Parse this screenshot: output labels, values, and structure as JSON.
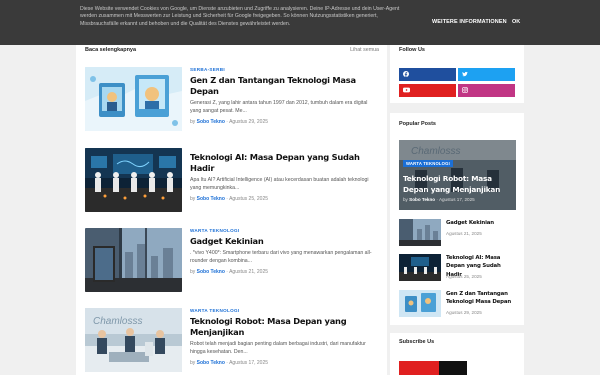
{
  "cookie_banner": {
    "text": "Diese Website verwendet Cookies von Google, um Dienste anzubieten und Zugriffe zu analysieren. Deine IP-Adresse und dein User-Agent werden zusammen mit Messwerten zur Leistung und Sicherheit für Google freigegeben. So können Nutzungsstatistiken generiert, Missbrauchsfälle erkannt und behoben und die Qualität des Dienstes gewährleistet werden.",
    "more_info": "WEITERE INFORMATIONEN",
    "ok": "OK"
  },
  "main": {
    "heading": "Baca selengkapnya",
    "see_all": "Lihat semua",
    "posts": [
      {
        "label": "SERBA-SERBI",
        "title": "Gen Z dan Tantangan Teknologi Masa Depan",
        "snippet": "Generasi Z, yang lahir antara tahun 1997 dan 2012, tumbuh dalam era digital yang sangat pesat. Me...",
        "by": "by",
        "author": "Sobo Tekno",
        "date": "Agustus 29, 2025"
      },
      {
        "label": "",
        "title": "Teknologi AI: Masa Depan yang Sudah Hadir",
        "snippet": "Apa Itu AI? Artificial Intelligence (AI) atau kecerdasan buatan adalah teknologi yang memungkinka...",
        "by": "by",
        "author": "Sobo Tekno",
        "date": "Agustus 25, 2025"
      },
      {
        "label": "WARTA TEKNOLOGI",
        "title": "Gadget Kekinian",
        "snippet": ". *vivo Y400*: Smartphone terbaru dari vivo yang menawarkan pengalaman all-rounder dengan kombina...",
        "by": "by",
        "author": "Sobo Tekno",
        "date": "Agustus 21, 2025"
      },
      {
        "label": "WARTA TEKNOLOGI",
        "title": "Teknologi Robot: Masa Depan yang Menjanjikan",
        "snippet": "Robot telah menjadi bagian penting dalam berbagai industri, dari manufaktur hingga kesehatan. Den...",
        "by": "by",
        "author": "Sobo Tekno",
        "date": "Agustus 17, 2025"
      }
    ]
  },
  "sidebar": {
    "follow_title": "Follow Us",
    "popular_title": "Popular Posts",
    "subscribe_title": "Subscribe Us",
    "social": [
      {
        "icon": "facebook-icon",
        "color": "#1f4f9e"
      },
      {
        "icon": "twitter-icon",
        "color": "#1da1f2"
      },
      {
        "icon": "youtube-icon",
        "color": "#e02020"
      },
      {
        "icon": "instagram-icon",
        "color": "#c13584"
      }
    ],
    "featured": {
      "label": "WARTA TEKNOLOGI",
      "title": "Teknologi Robot: Masa Depan yang Menjanjikan",
      "by": "by",
      "author": "Sobo Tekno",
      "date": "Agustus 17, 2025"
    },
    "popular": [
      {
        "title": "Gadget Kekinian",
        "date": "Agustus 21, 2025"
      },
      {
        "title": "Teknologi AI: Masa Depan yang Sudah Hadir",
        "date": "Agustus 25, 2025"
      },
      {
        "title": "Gen Z dan Tantangan Teknologi Masa Depan",
        "date": "Agustus 29, 2025"
      }
    ]
  },
  "colors": {
    "accent": "#1b6fd6",
    "cookie_bg": "#3a3a3a",
    "page_bg": "#f0f0f0"
  }
}
